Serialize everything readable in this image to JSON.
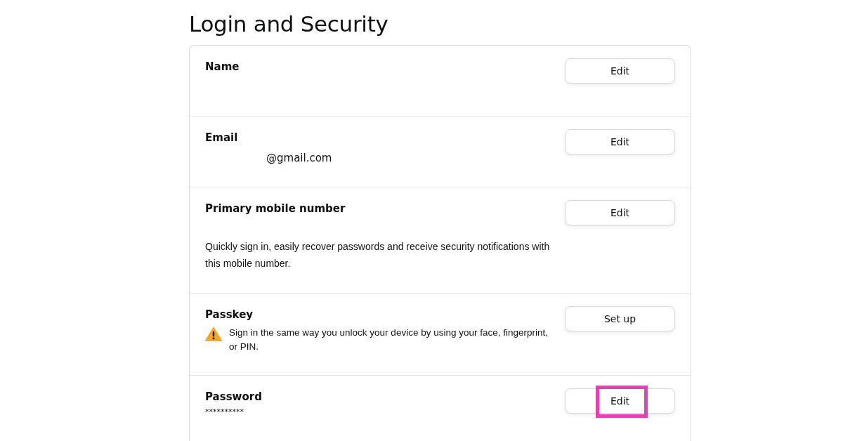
{
  "title": "Login and Security",
  "rows": [
    {
      "kind": "plain",
      "label": "Name",
      "button": {
        "label": "Edit",
        "highlighted": false
      }
    },
    {
      "kind": "redacted-value",
      "label": "Email",
      "value": "@gmail.com",
      "button": {
        "label": "Edit",
        "highlighted": false
      }
    },
    {
      "kind": "note",
      "label": "Primary mobile number",
      "text": "Quickly sign in, easily recover passwords and receive security notifications with this mobile number.",
      "button": {
        "label": "Edit",
        "highlighted": false
      }
    },
    {
      "kind": "warning",
      "label": "Passkey",
      "text": "Sign in the same way you unlock your device by using your face, fingerprint, or PIN.",
      "button": {
        "label": "Set up",
        "highlighted": false
      }
    },
    {
      "kind": "masked",
      "label": "Password",
      "value": "**********",
      "button": {
        "label": "Edit",
        "highlighted": true
      }
    }
  ]
}
